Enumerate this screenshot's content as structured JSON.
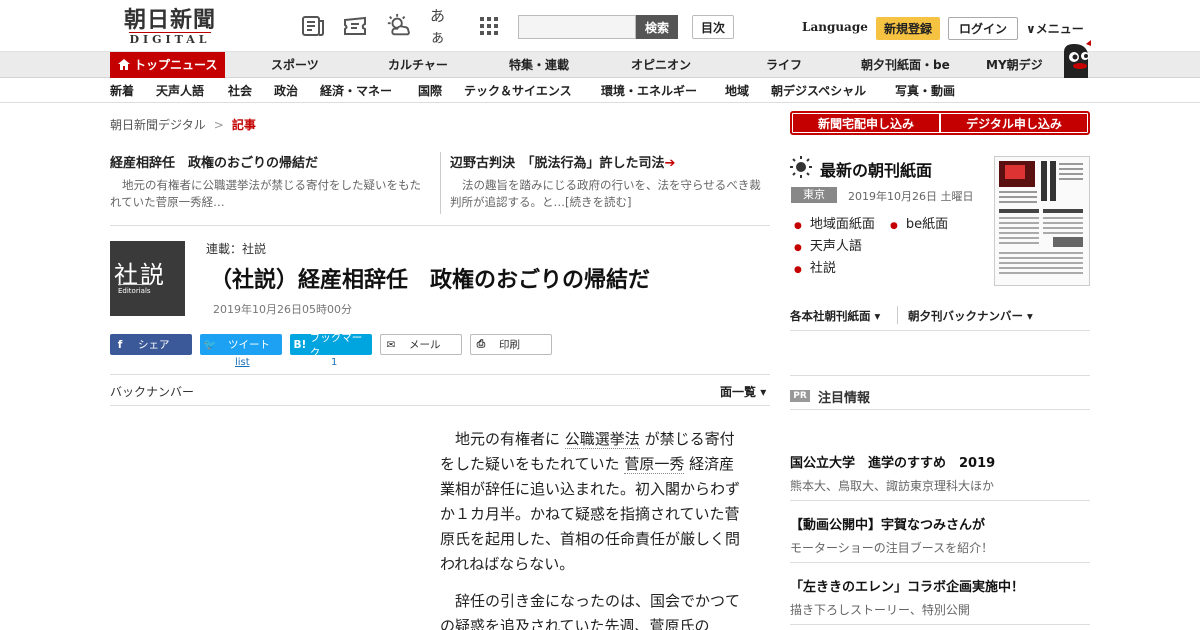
{
  "header": {
    "logo_ja": "朝日新聞",
    "logo_en": "DIGITAL",
    "font_size_label": "あぁ",
    "search_button": "検索",
    "search_placeholder": "",
    "toc_button": "目次",
    "language": "Language",
    "register": "新規登録",
    "login": "ログイン",
    "menu": "メニュー"
  },
  "gnav": [
    "トップニュース",
    "スポーツ",
    "カルチャー",
    "特集・連載",
    "オピニオン",
    "ライフ",
    "朝夕刊紙面・be",
    "MY朝デジ"
  ],
  "subnav": [
    "新着",
    "天声人語",
    "社会",
    "政治",
    "経済・マネー",
    "国際",
    "テック＆サイエンス",
    "環境・エネルギー",
    "地域",
    "朝デジスペシャル",
    "写真・動画"
  ],
  "breadcrumb": {
    "home": "朝日新聞デジタル",
    "sep": ">",
    "current": "記事"
  },
  "related": [
    {
      "title": "経産相辞任　政権のおごりの帰結だ",
      "body": "地元の有権者に公職選挙法が禁じる寄付をした疑いをもたれていた菅原一秀経…"
    },
    {
      "title": "辺野古判決　「脱法行為」許した司法",
      "body": "法の趣旨を踏みにじる政府の行いを、法を守らせるべき裁判所が追認する。と…[続きを読む]"
    }
  ],
  "article": {
    "thumb_kanji": "社説",
    "thumb_en": "Editorials",
    "series": "連載：社説",
    "headline": "（社説）経産相辞任　政権のおごりの帰結だ",
    "date": "2019年10月26日05時00分",
    "back_number": "バックナンバー",
    "page_list": "面一覧",
    "p1_a": "地元の有権者に",
    "p1_kw1": "公職選挙法",
    "p1_b": "が禁じる寄付をした疑いをもたれていた",
    "p1_kw2": "菅原一秀",
    "p1_c": "経済産業相が辞任に追い込まれた。初入閣からわずか１カ月半。かねて疑惑を指摘されていた菅原氏を起用した、首相の任命責任が厳しく問われねばならない。",
    "p2": "辞任の引き金になったのは、国会でかつての疑惑を追及されていた先週、菅原氏の"
  },
  "share": {
    "facebook": "シェア",
    "twitter": "ツイート",
    "twitter_count": "list",
    "hatena": "ブックマーク",
    "hatena_icon": "B!",
    "hatena_count": "1",
    "mail": "メール",
    "print": "印刷"
  },
  "sidebar": {
    "subscribe_paper": "新聞宅配申し込み",
    "subscribe_digital": "デジタル申し込み",
    "latest_title": "最新の朝刊紙面",
    "region": "東京",
    "paper_date": "2019年10月26日 土曜日",
    "links": [
      "地域面紙面",
      "be紙面",
      "天声人語",
      "社説"
    ],
    "dropdown1": "各本社朝刊紙面",
    "dropdown2": "朝夕刊バックナンバー",
    "pr_badge": "PR",
    "pr_title": "注目情報",
    "ads": [
      {
        "title": "国公立大学　進学のすすめ　2019",
        "sub": "熊本大、鳥取大、諏訪東京理科大ほか"
      },
      {
        "title": "【動画公開中】宇賀なつみさんが",
        "sub": "モーターショーの注目ブースを紹介！"
      },
      {
        "title": "「左ききのエレン」コラボ企画実施中！",
        "sub": "描き下ろしストーリー、特別公開"
      }
    ]
  },
  "colors": {
    "brand_red": "#c40000",
    "register_yellow": "#f5c242",
    "facebook": "#3b5998",
    "twitter": "#1da1f2",
    "hatena": "#00a4de"
  }
}
